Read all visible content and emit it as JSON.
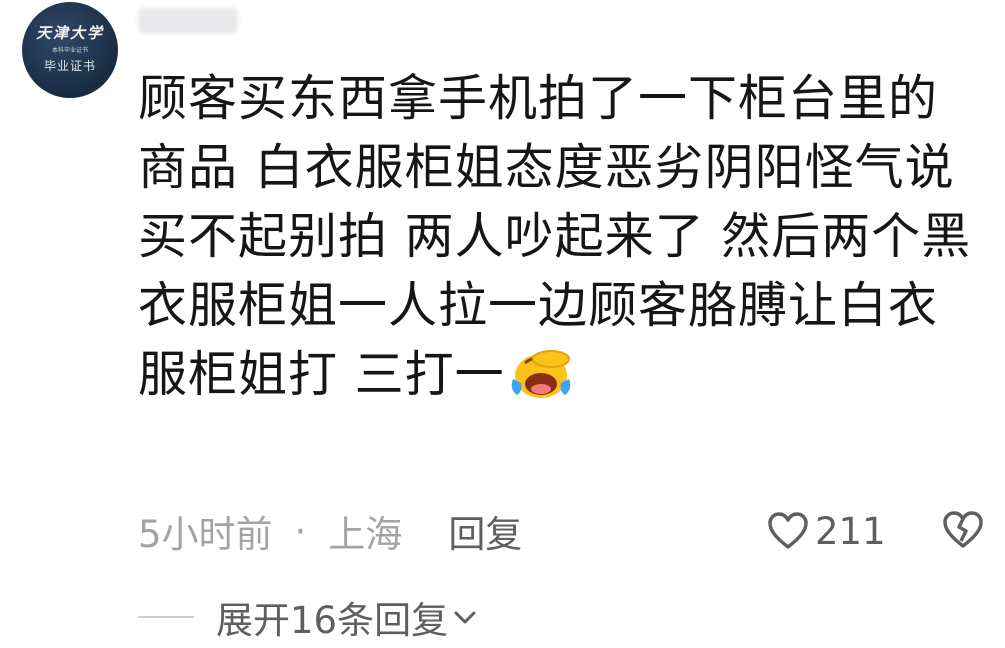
{
  "comment": {
    "avatar_text": {
      "line1": "天津大学",
      "line2": "本科毕业证书",
      "line3": "毕业证书"
    },
    "text": "顾客买东西拿手机拍了一下柜台里的\n商品 白衣服柜姐态度恶劣阴阳怪气说\n买不起别拍 两人吵起来了 然后两个黑\n衣服柜姐一人拉一边顾客胳膊让白衣\n服柜姐打 三打一",
    "emoji": "laughing-tears-emoji",
    "time": "5小时前",
    "separator": "·",
    "location": "上海",
    "reply_label": "回复",
    "likes": "211",
    "expand_label": "展开16条回复"
  },
  "colors": {
    "text": "#161616",
    "meta": "#a3a3a3",
    "action": "#5f5f5f",
    "avatar_bg": "#1a2c44"
  },
  "icons": [
    "heart-icon",
    "broken-heart-icon",
    "chevron-down-icon"
  ]
}
